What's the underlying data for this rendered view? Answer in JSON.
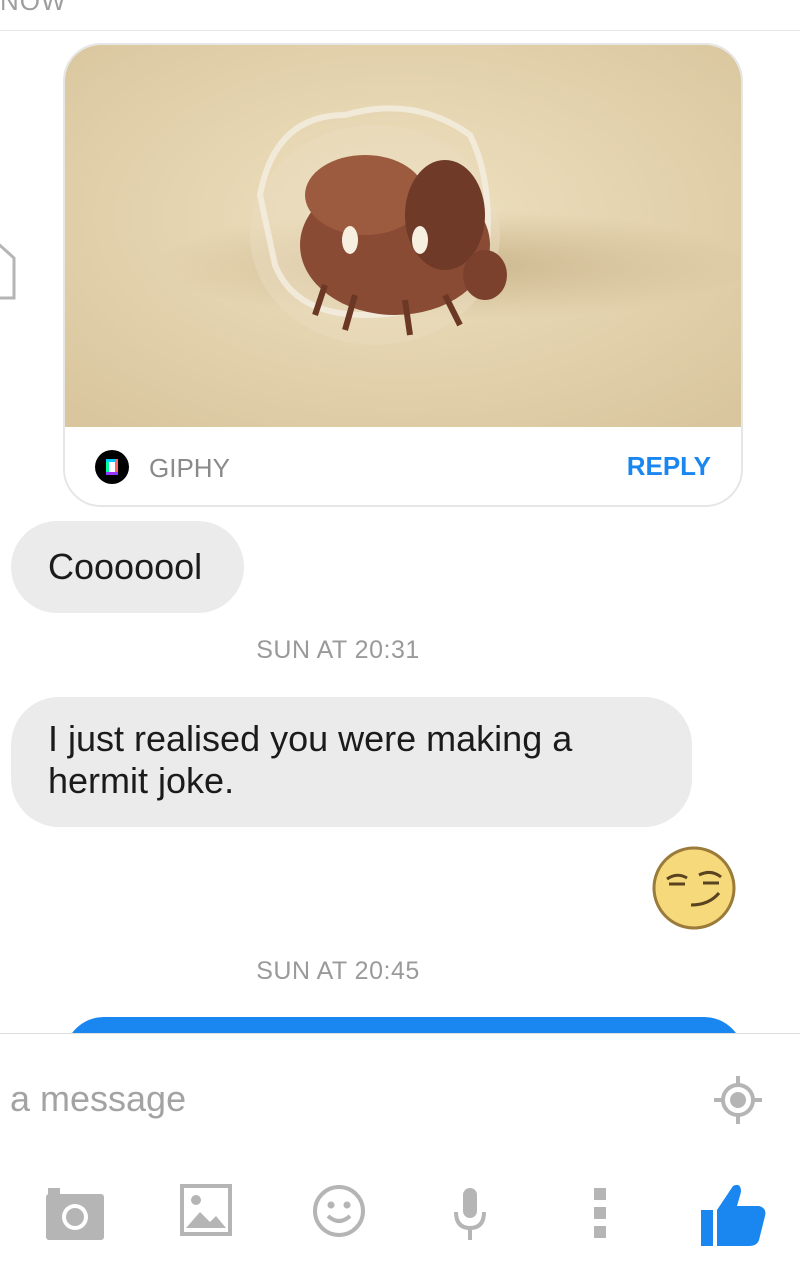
{
  "header": {
    "partial_title": "NOW"
  },
  "gif_card": {
    "provider": "GIPHY",
    "reply_label": "REPLY"
  },
  "messages": [
    {
      "text": "Cooooool"
    },
    {
      "text": "I just realised you were making a hermit joke."
    }
  ],
  "timestamps": [
    "SUN AT 20:31",
    "SUN AT 20:45"
  ],
  "composer": {
    "placeholder": "a message"
  },
  "toolbar": [
    "camera-icon",
    "gallery-icon",
    "emoji-icon",
    "microphone-icon",
    "more-icon",
    "like-icon"
  ],
  "colors": {
    "accent": "#1a86f0",
    "incoming_bubble": "#ebebeb",
    "icon_gray": "#b5b5b5"
  }
}
